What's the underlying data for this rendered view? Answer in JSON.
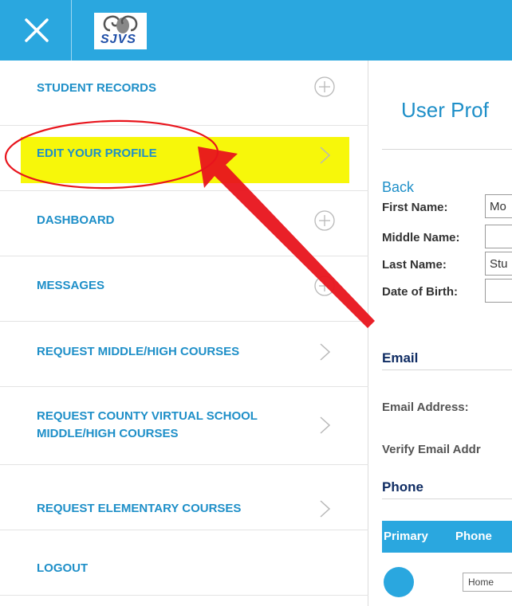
{
  "header": {
    "logo_text": "SJVS",
    "bg_color": "#2aa7df"
  },
  "sidebar": {
    "items": [
      {
        "label": "STUDENT RECORDS",
        "indicator": "plus-circle-icon"
      },
      {
        "label": "EDIT YOUR PROFILE",
        "indicator": "chevron-right-icon",
        "active": true
      },
      {
        "label": "DASHBOARD",
        "indicator": "plus-circle-icon"
      },
      {
        "label": "MESSAGES",
        "indicator": "plus-circle-icon"
      },
      {
        "label": "REQUEST MIDDLE/HIGH COURSES",
        "indicator": "chevron-right-icon"
      },
      {
        "label": "REQUEST COUNTY VIRTUAL SCHOOL MIDDLE/HIGH COURSES",
        "indicator": "chevron-right-icon"
      },
      {
        "label": "REQUEST ELEMENTARY COURSES",
        "indicator": "chevron-right-icon"
      },
      {
        "label": "LOGOUT",
        "indicator": "none"
      }
    ],
    "highlight_color": "#f7f70a"
  },
  "main": {
    "title": "User Prof",
    "back_label": "Back",
    "fields": [
      {
        "label": "First Name:",
        "value": "Mo"
      },
      {
        "label": "Middle Name:",
        "value": ""
      },
      {
        "label": "Last Name:",
        "value": "Stu"
      },
      {
        "label": "Date of Birth:",
        "value": ""
      }
    ],
    "email_section": "Email",
    "email_address_label": "Email Address:",
    "verify_email_label": "Verify Email Addr",
    "phone_section": "Phone",
    "phone_table": {
      "headers": [
        "Primary",
        "Phone"
      ],
      "row_type": "Home"
    }
  },
  "annotation": {
    "color": "#e8141c"
  }
}
